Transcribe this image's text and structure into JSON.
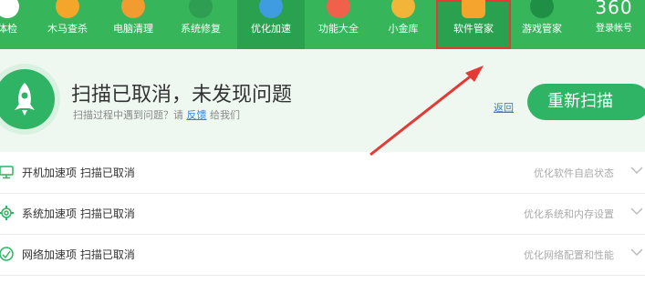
{
  "toolbar": {
    "items": [
      {
        "label": "体检"
      },
      {
        "label": "木马查杀"
      },
      {
        "label": "电脑清理"
      },
      {
        "label": "系统修复"
      },
      {
        "label": "优化加速"
      },
      {
        "label": "功能大全"
      },
      {
        "label": "小金库"
      },
      {
        "label": "软件管家"
      },
      {
        "label": "游戏管家"
      }
    ],
    "brand": "360",
    "login": "登录帐号",
    "colors": {
      "bar": "#36b55b",
      "highlight_box": "#e53935"
    }
  },
  "status": {
    "title": "扫描已取消，未发现问题",
    "sub_prefix": "扫描过程中遇到问题？请",
    "sub_link": "反馈",
    "sub_suffix": "给我们",
    "back": "返回",
    "rescan": "重新扫描"
  },
  "rows": [
    {
      "label": "开机加速项 扫描已取消",
      "desc": "优化软件自启状态",
      "icon": "monitor-icon"
    },
    {
      "label": "系统加速项 扫描已取消",
      "desc": "优化系统和内存设置",
      "icon": "gear-icon"
    },
    {
      "label": "网络加速项 扫描已取消",
      "desc": "优化网络配置和性能",
      "icon": "network-icon"
    }
  ]
}
